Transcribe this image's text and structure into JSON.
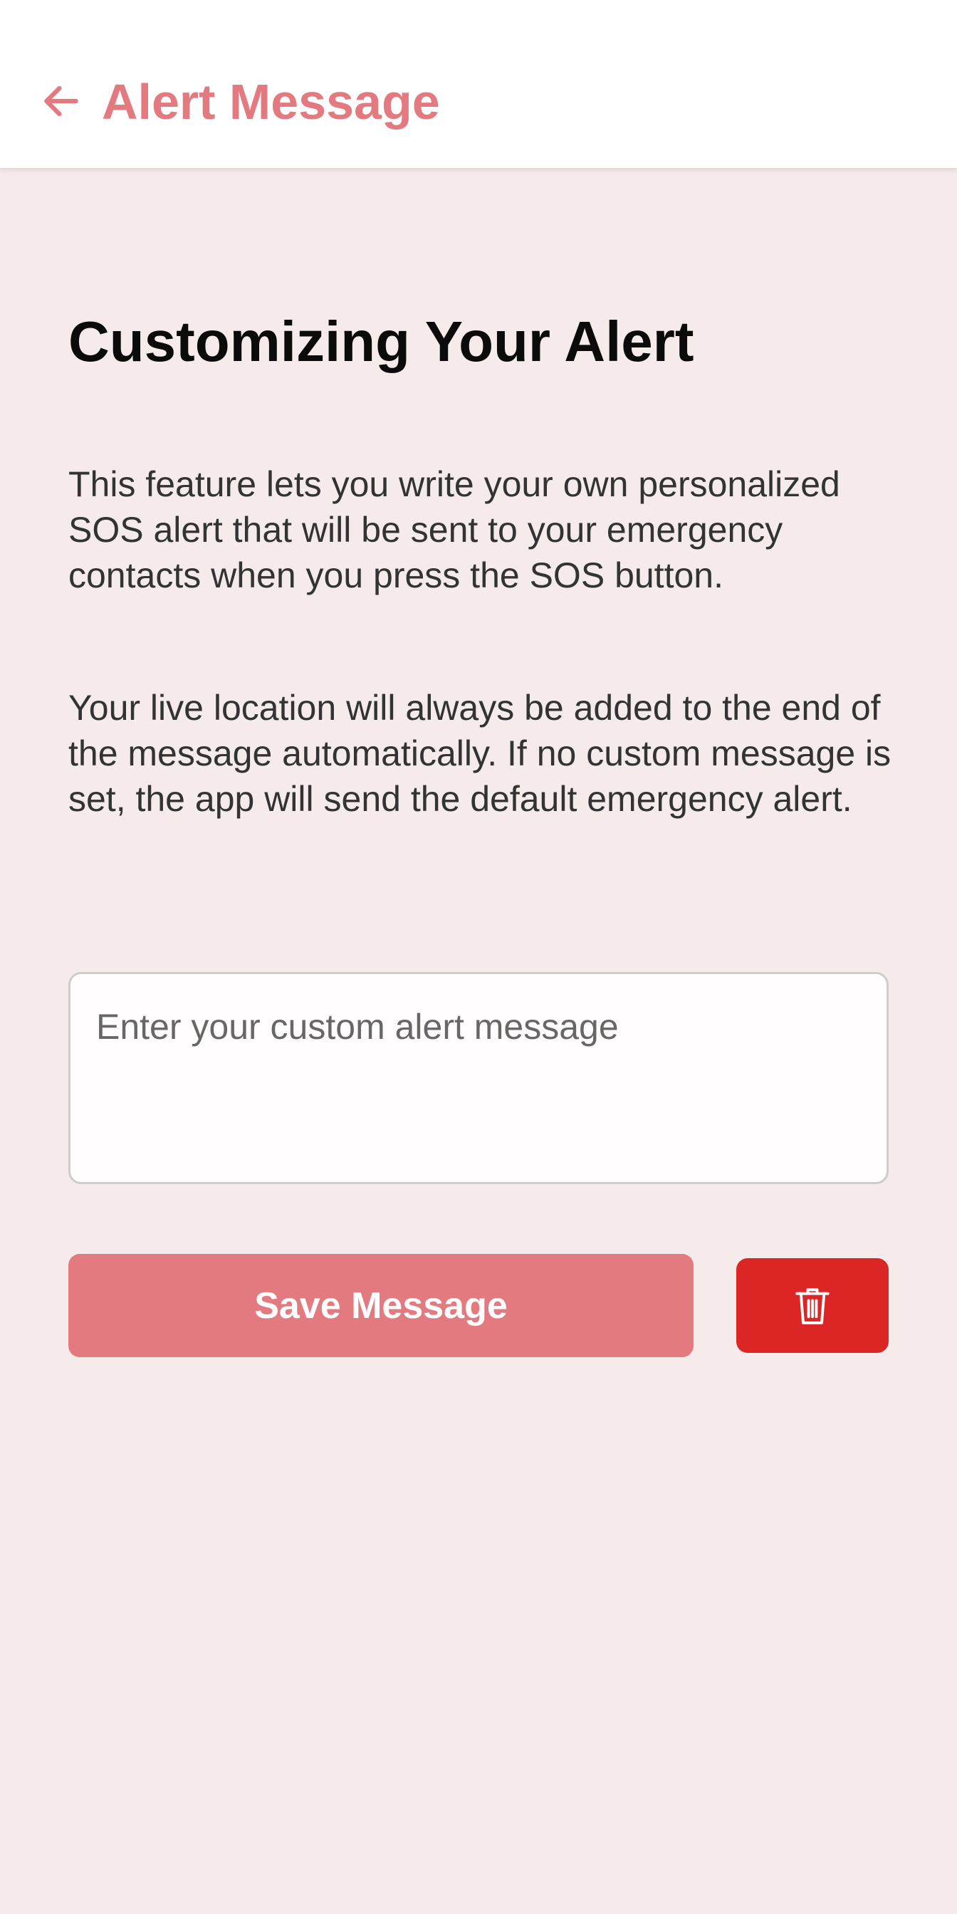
{
  "app_bar": {
    "title": "Alert Message",
    "back_icon": "arrow-left-icon",
    "accent_color": "#e27a80"
  },
  "content": {
    "heading": "Customizing Your Alert",
    "paragraph_1": "This feature lets you write your own personalized SOS alert that will be sent to your emergency contacts when you press the SOS button.",
    "paragraph_2": "Your live location will always be added to the end of the message automatically. If no custom message is set, the app will send the default emergency alert."
  },
  "message_input": {
    "value": "",
    "placeholder": "Enter your custom alert message"
  },
  "actions": {
    "save_label": "Save Message",
    "save_color": "#e27a80",
    "delete_icon": "trash-icon",
    "delete_color": "#dc2626"
  }
}
